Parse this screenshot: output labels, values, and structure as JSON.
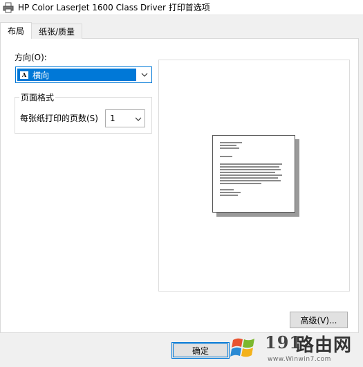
{
  "window": {
    "title": "HP Color LaserJet 1600 Class Driver 打印首选项"
  },
  "tabs": [
    {
      "label": "布局",
      "active": true
    },
    {
      "label": "纸张/质量",
      "active": false
    }
  ],
  "layout": {
    "orientation_label": "方向(O):",
    "orientation_value": "横向",
    "orientation_glyph": "A",
    "page_format_legend": "页面格式",
    "pages_per_sheet_label": "每张纸打印的页数(S)",
    "pages_per_sheet_value": "1"
  },
  "buttons": {
    "advanced": "高级(V)...",
    "ok": "确定"
  },
  "watermark": {
    "number": "191",
    "text": "路由网",
    "url": "www.Winwin7.com"
  },
  "colors": {
    "accent": "#0078d7",
    "panel": "#ffffff",
    "chrome": "#f0f0f0"
  }
}
